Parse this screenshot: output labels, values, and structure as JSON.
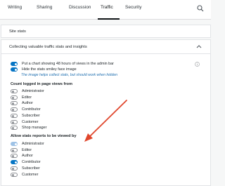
{
  "tabs": [
    {
      "label": "Writing",
      "active": false
    },
    {
      "label": "Sharing",
      "active": false
    },
    {
      "label": "Discussion",
      "active": false
    },
    {
      "label": "Traffic",
      "active": true
    },
    {
      "label": "Security",
      "active": false
    }
  ],
  "section_title": "Site stats",
  "card": {
    "title": "Collecting valuable traffic stats and insights",
    "toggles": [
      {
        "label": "Put a chart showing 48 hours of views in the admin bar",
        "on": true
      },
      {
        "label": "Hide the stats smiley face image",
        "on": true
      }
    ],
    "help_text": "The image helps collect stats, but should work when hidden",
    "count_group": {
      "title": "Count logged in page views from",
      "items": [
        {
          "label": "Administrator",
          "on": false
        },
        {
          "label": "Editor",
          "on": false
        },
        {
          "label": "Author",
          "on": false
        },
        {
          "label": "Contributor",
          "on": false
        },
        {
          "label": "Subscriber",
          "on": false
        },
        {
          "label": "Customer",
          "on": false
        },
        {
          "label": "Shop manager",
          "on": false
        }
      ]
    },
    "view_group": {
      "title": "Allow stats reports to be viewed by",
      "items": [
        {
          "label": "Administrator",
          "on": true,
          "disabled": true
        },
        {
          "label": "Editor",
          "on": false
        },
        {
          "label": "Author",
          "on": false
        },
        {
          "label": "Contributor",
          "on": true
        },
        {
          "label": "Subscriber",
          "on": false
        },
        {
          "label": "Customer",
          "on": false
        }
      ]
    }
  },
  "colors": {
    "accent": "#0675c4",
    "arrow": "#e0462c"
  },
  "icons": {
    "search": "search-icon",
    "chevron": "chevron-up-icon",
    "info": "info-icon"
  }
}
